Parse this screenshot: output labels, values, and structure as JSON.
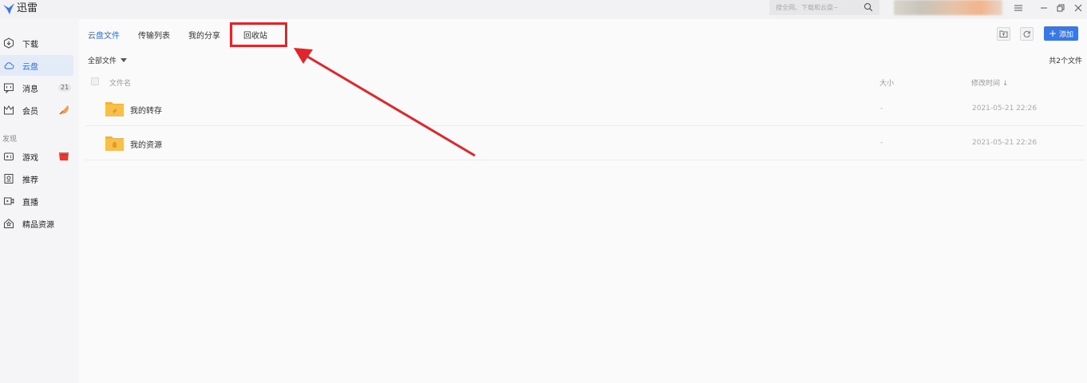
{
  "app": {
    "title": "迅雷"
  },
  "search": {
    "placeholder": "搜全网、下载和云盘~"
  },
  "sidebar": {
    "items": [
      {
        "label": "下载"
      },
      {
        "label": "云盘"
      },
      {
        "label": "消息",
        "badge": "21"
      },
      {
        "label": "会员"
      },
      {
        "label": "游戏"
      },
      {
        "label": "推荐"
      },
      {
        "label": "直播"
      },
      {
        "label": "精品资源"
      }
    ],
    "section_label": "发现"
  },
  "tabs": [
    {
      "label": "云盘文件"
    },
    {
      "label": "传输列表"
    },
    {
      "label": "我的分享"
    },
    {
      "label": "回收站"
    }
  ],
  "toolbar": {
    "add_label": "添加"
  },
  "filter": {
    "label": "全部文件"
  },
  "file_count": "共2个文件",
  "columns": {
    "name": "文件名",
    "size": "大小",
    "modified": "修改时间 ↓"
  },
  "files": [
    {
      "name": "我的转存",
      "size": "-",
      "modified": "2021-05-21 22:26"
    },
    {
      "name": "我的资源",
      "size": "-",
      "modified": "2021-05-21 22:26"
    }
  ],
  "colors": {
    "accent": "#3b78e7",
    "highlight": "#e0262b",
    "folder": "#f5b335"
  }
}
